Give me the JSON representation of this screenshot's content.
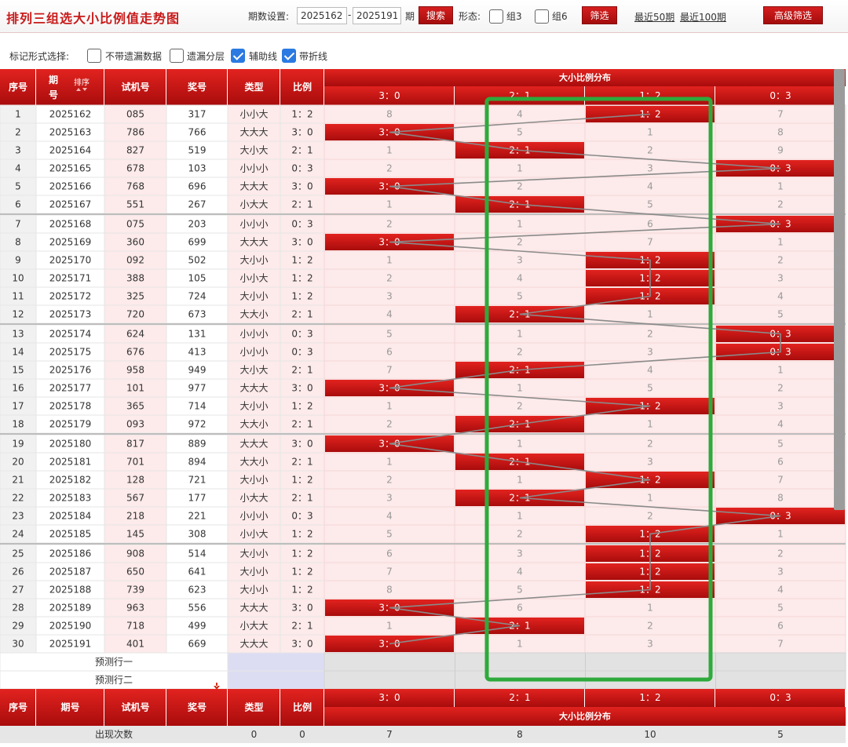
{
  "header": {
    "title": "排列三组选大小比例值走势图",
    "period_label": "期数设置:",
    "period_start": "2025162",
    "period_sep": "-",
    "period_end": "2025191",
    "period_unit": "期",
    "search_label": "搜索",
    "form_label": "形态:",
    "group3_label": "组3",
    "group6_label": "组6",
    "filter_label": "筛选",
    "recent50": "最近50期",
    "recent100": "最近100期",
    "advanced_label": "高级筛选"
  },
  "mark_options": {
    "label": "标记形式选择:",
    "items": [
      {
        "label": "不带遗漏数据",
        "checked": false
      },
      {
        "label": "遗漏分层",
        "checked": false
      },
      {
        "label": "辅助线",
        "checked": true
      },
      {
        "label": "带折线",
        "checked": true
      }
    ]
  },
  "table": {
    "headers": {
      "seq": "序号",
      "period": "期号",
      "sort": "排序",
      "trial": "试机号",
      "prize": "奖号",
      "type": "类型",
      "ratio": "比例",
      "dist": "大小比例分布"
    },
    "dist_columns": [
      "3：0",
      "2：1",
      "1：2",
      "0：3"
    ],
    "rows": [
      {
        "seq": "1",
        "period": "2025162",
        "trial": "085",
        "prize": "317",
        "type": "小小大",
        "ratio": "1：2",
        "hit": 2,
        "cells": [
          "8",
          "4",
          "1：2",
          "7"
        ]
      },
      {
        "seq": "2",
        "period": "2025163",
        "trial": "786",
        "prize": "766",
        "type": "大大大",
        "ratio": "3：0",
        "hit": 0,
        "cells": [
          "3：0",
          "5",
          "1",
          "8"
        ]
      },
      {
        "seq": "3",
        "period": "2025164",
        "trial": "827",
        "prize": "519",
        "type": "大小大",
        "ratio": "2：1",
        "hit": 1,
        "cells": [
          "1",
          "2：1",
          "2",
          "9"
        ]
      },
      {
        "seq": "4",
        "period": "2025165",
        "trial": "678",
        "prize": "103",
        "type": "小小小",
        "ratio": "0：3",
        "hit": 3,
        "cells": [
          "2",
          "1",
          "3",
          "0：3"
        ]
      },
      {
        "seq": "5",
        "period": "2025166",
        "trial": "768",
        "prize": "696",
        "type": "大大大",
        "ratio": "3：0",
        "hit": 0,
        "cells": [
          "3：0",
          "2",
          "4",
          "1"
        ]
      },
      {
        "seq": "6",
        "period": "2025167",
        "trial": "551",
        "prize": "267",
        "type": "小大大",
        "ratio": "2：1",
        "hit": 1,
        "cells": [
          "1",
          "2：1",
          "5",
          "2"
        ]
      },
      {
        "seq": "7",
        "period": "2025168",
        "trial": "075",
        "prize": "203",
        "type": "小小小",
        "ratio": "0：3",
        "hit": 3,
        "cells": [
          "2",
          "1",
          "6",
          "0：3"
        ]
      },
      {
        "seq": "8",
        "period": "2025169",
        "trial": "360",
        "prize": "699",
        "type": "大大大",
        "ratio": "3：0",
        "hit": 0,
        "cells": [
          "3：0",
          "2",
          "7",
          "1"
        ]
      },
      {
        "seq": "9",
        "period": "2025170",
        "trial": "092",
        "prize": "502",
        "type": "大小小",
        "ratio": "1：2",
        "hit": 2,
        "cells": [
          "1",
          "3",
          "1：2",
          "2"
        ]
      },
      {
        "seq": "10",
        "period": "2025171",
        "trial": "388",
        "prize": "105",
        "type": "小小大",
        "ratio": "1：2",
        "hit": 2,
        "cells": [
          "2",
          "4",
          "1：2",
          "3"
        ]
      },
      {
        "seq": "11",
        "period": "2025172",
        "trial": "325",
        "prize": "724",
        "type": "大小小",
        "ratio": "1：2",
        "hit": 2,
        "cells": [
          "3",
          "5",
          "1：2",
          "4"
        ]
      },
      {
        "seq": "12",
        "period": "2025173",
        "trial": "720",
        "prize": "673",
        "type": "大大小",
        "ratio": "2：1",
        "hit": 1,
        "cells": [
          "4",
          "2：1",
          "1",
          "5"
        ]
      },
      {
        "seq": "13",
        "period": "2025174",
        "trial": "624",
        "prize": "131",
        "type": "小小小",
        "ratio": "0：3",
        "hit": 3,
        "cells": [
          "5",
          "1",
          "2",
          "0：3"
        ]
      },
      {
        "seq": "14",
        "period": "2025175",
        "trial": "676",
        "prize": "413",
        "type": "小小小",
        "ratio": "0：3",
        "hit": 3,
        "cells": [
          "6",
          "2",
          "3",
          "0：3"
        ]
      },
      {
        "seq": "15",
        "period": "2025176",
        "trial": "958",
        "prize": "949",
        "type": "大小大",
        "ratio": "2：1",
        "hit": 1,
        "cells": [
          "7",
          "2：1",
          "4",
          "1"
        ]
      },
      {
        "seq": "16",
        "period": "2025177",
        "trial": "101",
        "prize": "977",
        "type": "大大大",
        "ratio": "3：0",
        "hit": 0,
        "cells": [
          "3：0",
          "1",
          "5",
          "2"
        ]
      },
      {
        "seq": "17",
        "period": "2025178",
        "trial": "365",
        "prize": "714",
        "type": "大小小",
        "ratio": "1：2",
        "hit": 2,
        "cells": [
          "1",
          "2",
          "1：2",
          "3"
        ]
      },
      {
        "seq": "18",
        "period": "2025179",
        "trial": "093",
        "prize": "972",
        "type": "大大小",
        "ratio": "2：1",
        "hit": 1,
        "cells": [
          "2",
          "2：1",
          "1",
          "4"
        ]
      },
      {
        "seq": "19",
        "period": "2025180",
        "trial": "817",
        "prize": "889",
        "type": "大大大",
        "ratio": "3：0",
        "hit": 0,
        "cells": [
          "3：0",
          "1",
          "2",
          "5"
        ]
      },
      {
        "seq": "20",
        "period": "2025181",
        "trial": "701",
        "prize": "894",
        "type": "大大小",
        "ratio": "2：1",
        "hit": 1,
        "cells": [
          "1",
          "2：1",
          "3",
          "6"
        ]
      },
      {
        "seq": "21",
        "period": "2025182",
        "trial": "128",
        "prize": "721",
        "type": "大小小",
        "ratio": "1：2",
        "hit": 2,
        "cells": [
          "2",
          "1",
          "1：2",
          "7"
        ]
      },
      {
        "seq": "22",
        "period": "2025183",
        "trial": "567",
        "prize": "177",
        "type": "小大大",
        "ratio": "2：1",
        "hit": 1,
        "cells": [
          "3",
          "2：1",
          "1",
          "8"
        ]
      },
      {
        "seq": "23",
        "period": "2025184",
        "trial": "218",
        "prize": "221",
        "type": "小小小",
        "ratio": "0：3",
        "hit": 3,
        "cells": [
          "4",
          "1",
          "2",
          "0：3"
        ]
      },
      {
        "seq": "24",
        "period": "2025185",
        "trial": "145",
        "prize": "308",
        "type": "小小大",
        "ratio": "1：2",
        "hit": 2,
        "cells": [
          "5",
          "2",
          "1：2",
          "1"
        ]
      },
      {
        "seq": "25",
        "period": "2025186",
        "trial": "908",
        "prize": "514",
        "type": "大小小",
        "ratio": "1：2",
        "hit": 2,
        "cells": [
          "6",
          "3",
          "1：2",
          "2"
        ]
      },
      {
        "seq": "26",
        "period": "2025187",
        "trial": "650",
        "prize": "641",
        "type": "大小小",
        "ratio": "1：2",
        "hit": 2,
        "cells": [
          "7",
          "4",
          "1：2",
          "3"
        ]
      },
      {
        "seq": "27",
        "period": "2025188",
        "trial": "739",
        "prize": "623",
        "type": "大小小",
        "ratio": "1：2",
        "hit": 2,
        "cells": [
          "8",
          "5",
          "1：2",
          "4"
        ]
      },
      {
        "seq": "28",
        "period": "2025189",
        "trial": "963",
        "prize": "556",
        "type": "大大大",
        "ratio": "3：0",
        "hit": 0,
        "cells": [
          "3：0",
          "6",
          "1",
          "5"
        ]
      },
      {
        "seq": "29",
        "period": "2025190",
        "trial": "718",
        "prize": "499",
        "type": "小大大",
        "ratio": "2：1",
        "hit": 1,
        "cells": [
          "1",
          "2：1",
          "2",
          "6"
        ]
      },
      {
        "seq": "30",
        "period": "2025191",
        "trial": "401",
        "prize": "669",
        "type": "大大大",
        "ratio": "3：0",
        "hit": 0,
        "cells": [
          "3：0",
          "1",
          "3",
          "7"
        ]
      }
    ],
    "predict_rows": [
      "预测行一",
      "预测行二"
    ],
    "footer": {
      "label": "出现次数",
      "type_count": "0",
      "ratio_count": "0",
      "counts": [
        "7",
        "8",
        "10",
        "5"
      ]
    }
  },
  "colors": {
    "accent": "#c81a1a",
    "hit": "#c51616",
    "row_alt": "#fdeaea",
    "highlight": "#2eaa3c",
    "header_bg": "#b80f0f"
  }
}
